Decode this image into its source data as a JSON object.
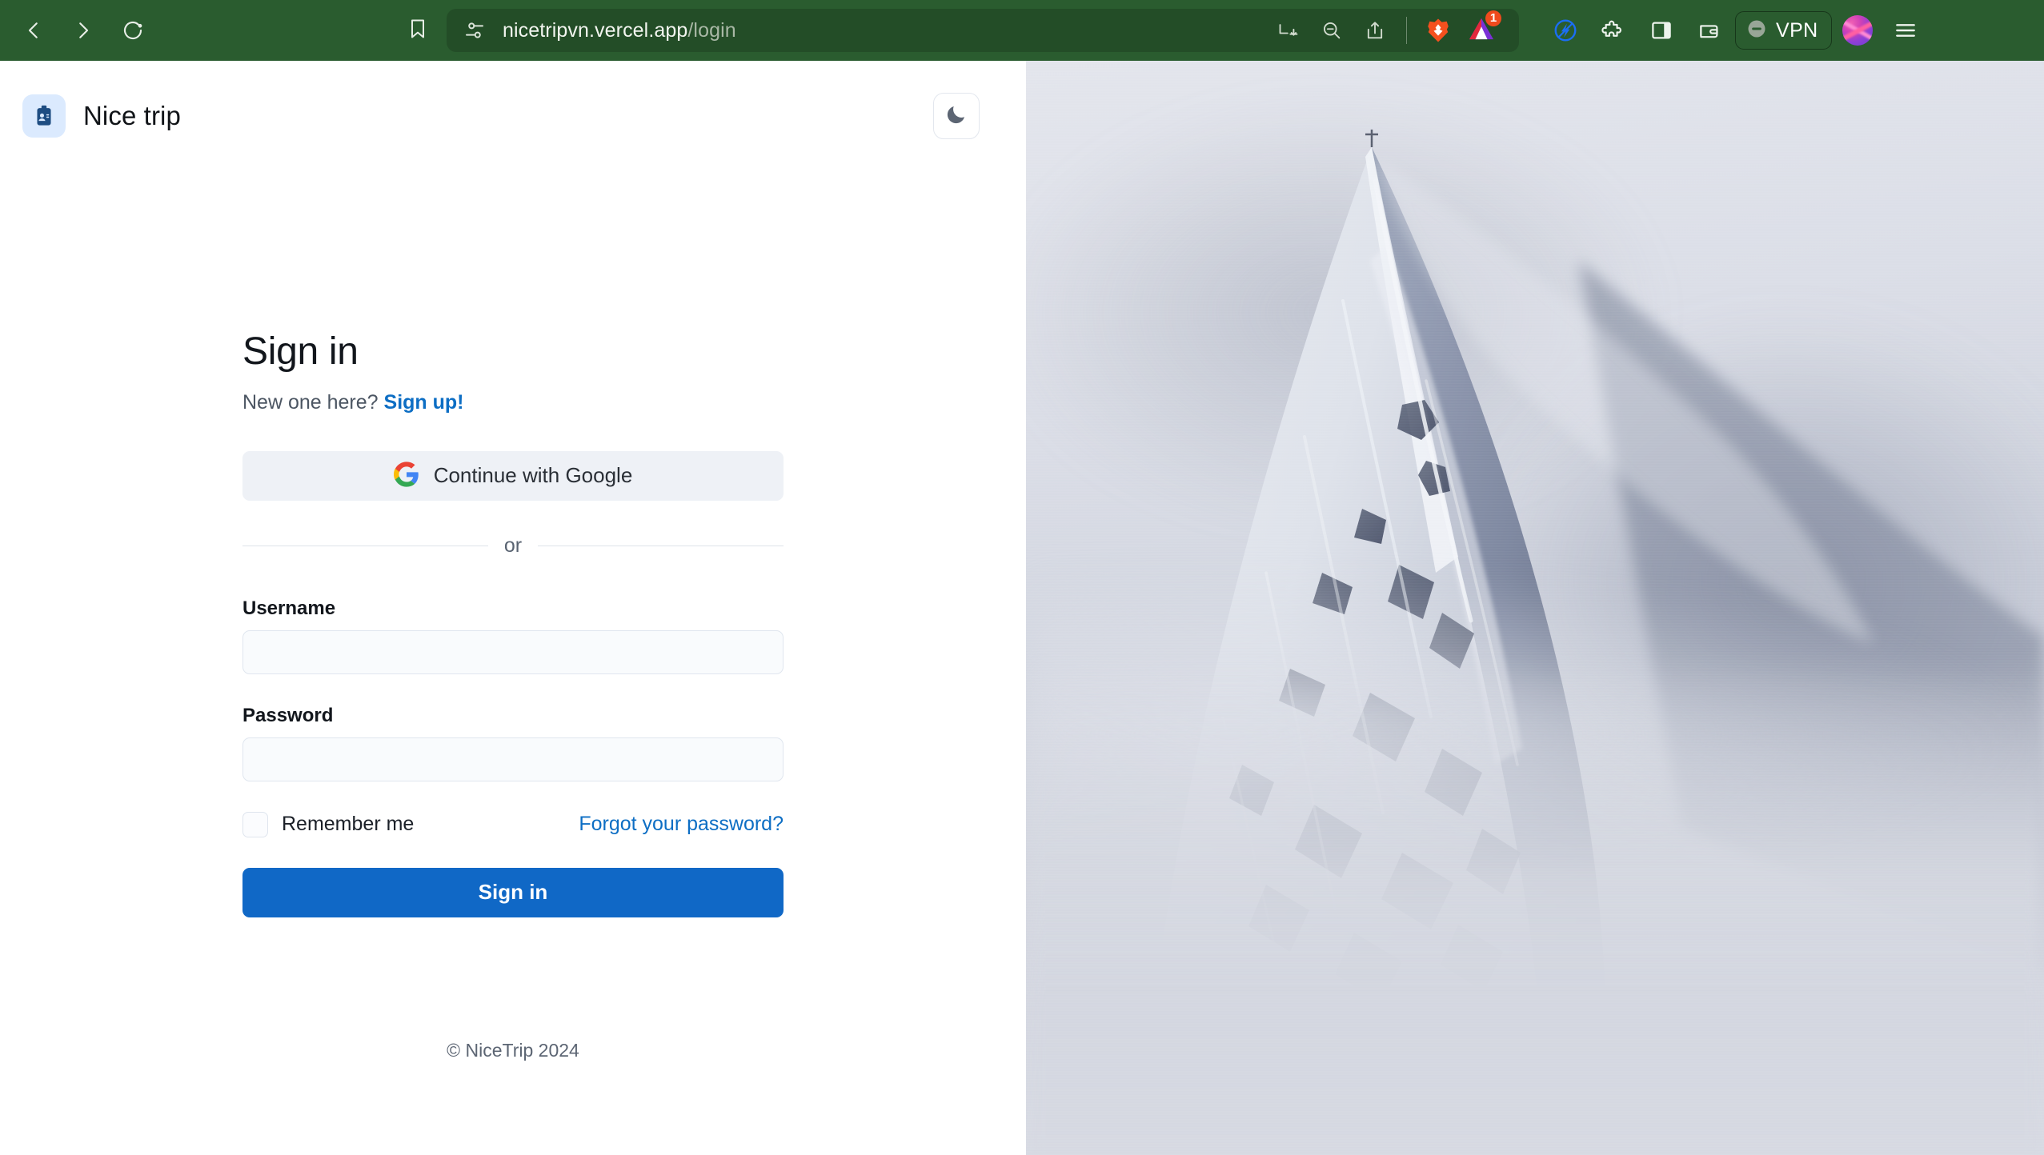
{
  "browser": {
    "nav": {
      "back_icon": "chevron-left-icon",
      "forward_icon": "chevron-right-icon",
      "reload_icon": "reload-icon",
      "bookmark_icon": "bookmark-icon"
    },
    "urlbar": {
      "site_settings_icon": "sliders-icon",
      "host": "nicetripvn.vercel.app",
      "path": "/login",
      "actions": [
        {
          "icon": "download-panel-icon",
          "name": "download-icon"
        },
        {
          "icon": "zoom-out-icon",
          "name": "zoom-out-icon"
        },
        {
          "icon": "share-icon",
          "name": "share-icon"
        }
      ],
      "brave_shield_icon": "brave-lion-icon",
      "rewards_icon": "brave-rewards-triangle-icon",
      "rewards_badge": "1"
    },
    "right_actions": {
      "speedreader_icon": "speedreader-bolt-icon",
      "extensions_icon": "puzzle-extensions-icon",
      "sidebar_icon": "sidebar-panel-icon",
      "wallet_icon": "wallet-icon",
      "vpn_label": "VPN",
      "vpn_status_icon": "vpn-disconnected-icon",
      "profile_avatar_icon": "profile-avatar-icon",
      "menu_icon": "hamburger-menu-icon"
    },
    "colors": {
      "toolbar_bg": "#2a5c2f",
      "urlbar_bg": "#234d27",
      "badge_bg": "#f04a1d"
    }
  },
  "header": {
    "logo_icon": "id-badge-icon",
    "brand_name": "Nice trip",
    "theme_toggle_icon": "moon-icon"
  },
  "signin": {
    "title": "Sign in",
    "new_here_text": "New one here?",
    "signup_link": "Sign up!",
    "google_button": {
      "label": "Continue with Google",
      "icon": "google-g-icon"
    },
    "divider_text": "or",
    "fields": [
      {
        "label": "Username",
        "value": "",
        "placeholder": "",
        "type": "text",
        "name": "username"
      },
      {
        "label": "Password",
        "value": "",
        "placeholder": "",
        "type": "password",
        "name": "password"
      }
    ],
    "remember_label": "Remember me",
    "remember_checked": false,
    "forgot_link": "Forgot your password?",
    "submit_label": "Sign in"
  },
  "footer": {
    "copyright": "© NiceTrip 2024"
  },
  "hero": {
    "alt": "snow-covered mountain peak shrouded in mist"
  },
  "colors": {
    "accent": "#1068c6",
    "link": "#0d6ec4",
    "logo_bg": "#dbeafe",
    "google_btn_bg": "#eef1f6",
    "input_bg": "#f9fbfd",
    "input_border": "#e0e6ef"
  }
}
